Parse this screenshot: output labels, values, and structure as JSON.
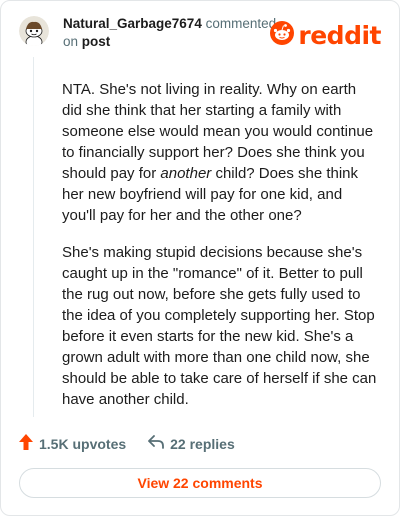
{
  "colors": {
    "brand": "#ff4500",
    "muted": "#576f76",
    "text": "#1c1c1c"
  },
  "header": {
    "username": "Natural_Garbage7674",
    "action": "commented",
    "on": "on",
    "post_link": "post"
  },
  "logo": {
    "word": "reddit",
    "icon": "reddit-snoo-icon"
  },
  "comment": {
    "paragraph1_a": "NTA. She's not living in reality. Why on earth did she think that her starting a family with someone else would mean you would continue to financially support her? Does she think you should pay for ",
    "paragraph1_em": "another",
    "paragraph1_b": " child? Does she think her new boyfriend will pay for one kid, and you'll pay for her and the other one?",
    "paragraph2": "She's making stupid decisions because she's caught up in the \"romance\" of it. Better to pull the rug out now, before she gets fully used to the idea of you completely supporting her. Stop before it even starts for the new kid. She's a grown adult with more than one child now, she should be able to take care of herself if she can have another child."
  },
  "actions": {
    "upvotes": "1.5K upvotes",
    "upvote_icon": "upvote-arrow-icon",
    "replies": "22 replies",
    "reply_icon": "reply-arrow-icon"
  },
  "view_comments": "View 22 comments"
}
